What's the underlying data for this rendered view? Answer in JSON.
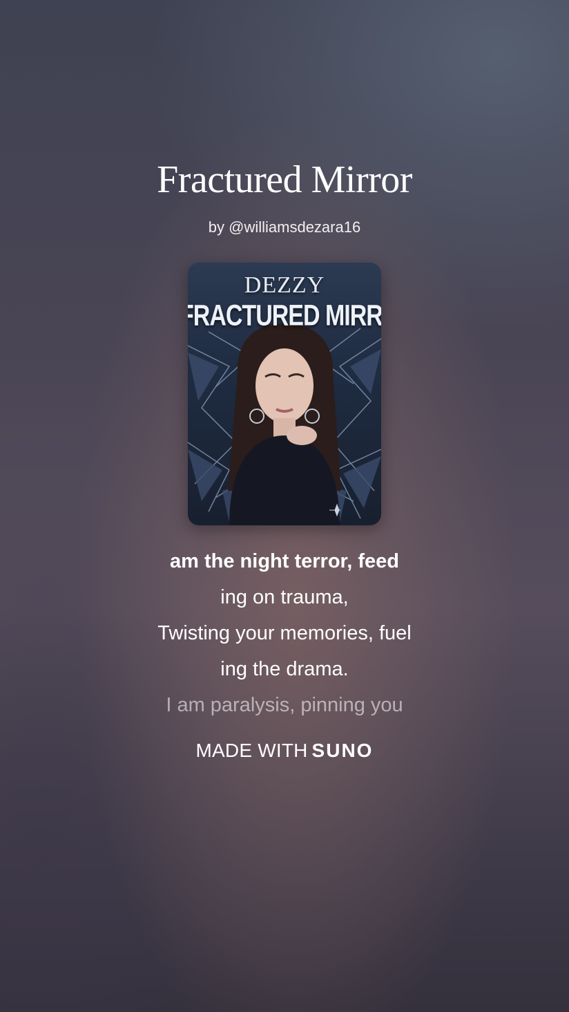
{
  "song": {
    "title": "Fractured Mirror",
    "byline": "by @williamsdezara16"
  },
  "cover": {
    "artist_text": "DEZZY",
    "title_text": "FRACTURED MIRROR",
    "icon": "album-cover-art"
  },
  "lyrics": {
    "lines": [
      "am the night terror, feed",
      "ing on trauma,",
      "Twisting your memories, fuel",
      "ing the drama.",
      "I am paralysis, pinning you"
    ],
    "active_index": 0
  },
  "branding": {
    "made_with": "MADE WITH",
    "brand": "SUNO"
  },
  "colors": {
    "text": "#ffffff",
    "faded_text": "rgba(255,255,255,0.55)",
    "background_mid": "#564d5c",
    "cover_bg": "#1f2c42"
  }
}
